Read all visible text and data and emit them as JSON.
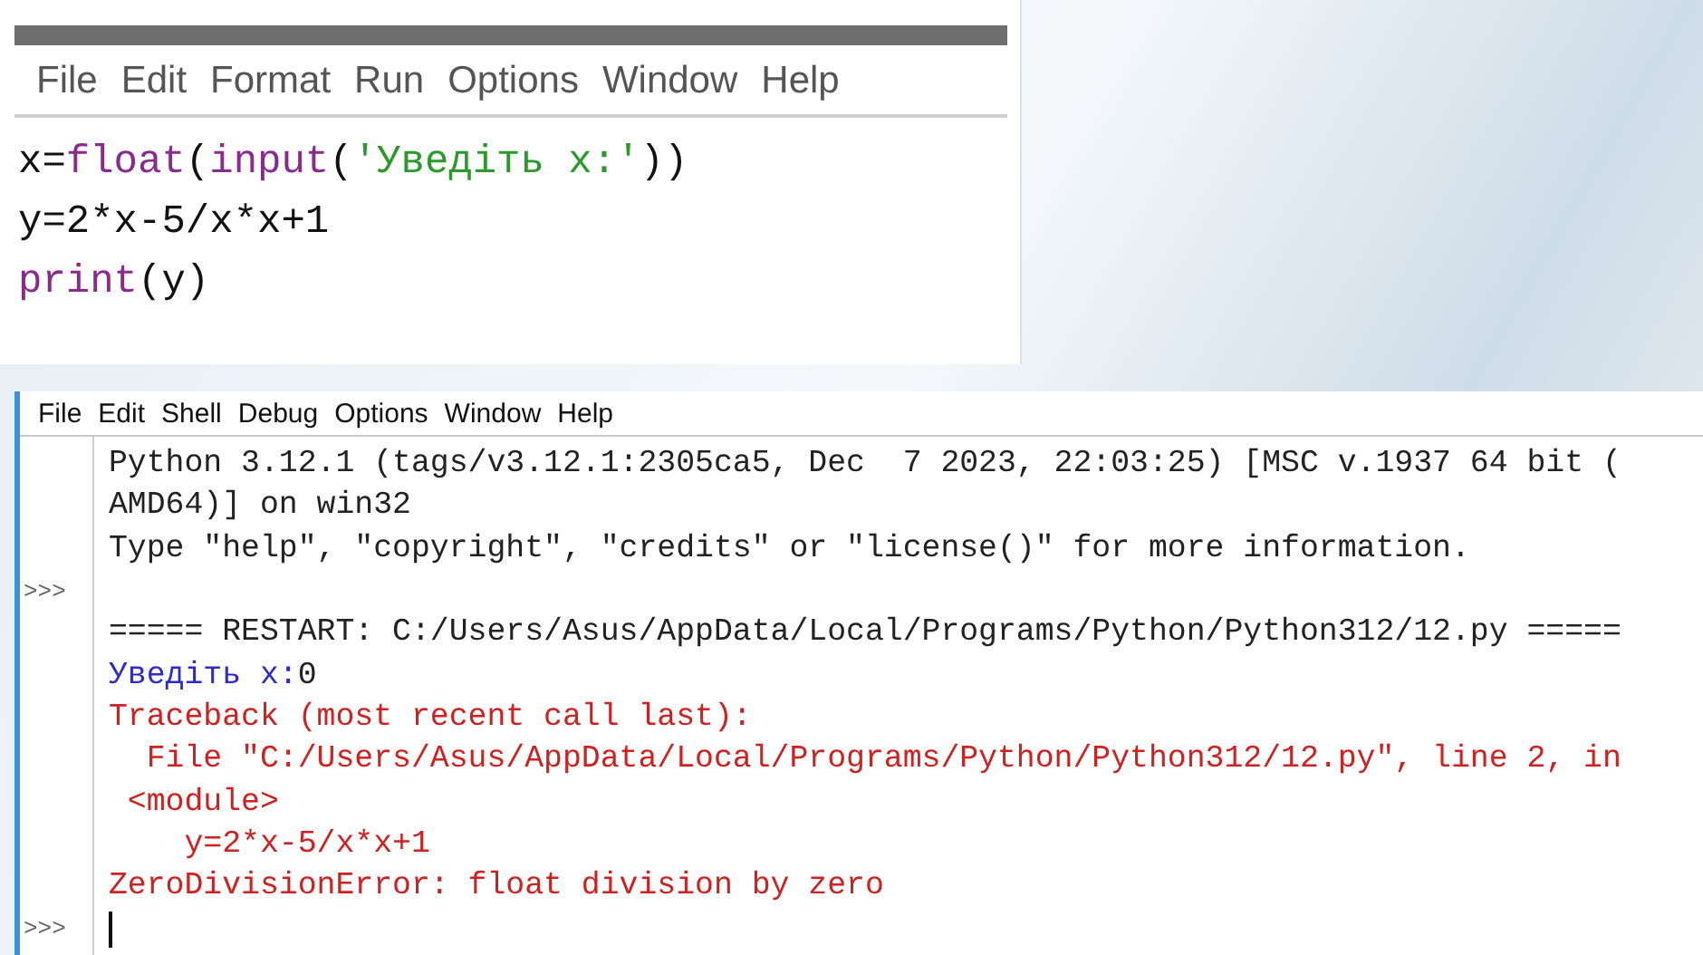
{
  "editor": {
    "menu": [
      "File",
      "Edit",
      "Format",
      "Run",
      "Options",
      "Window",
      "Help"
    ],
    "code": [
      [
        {
          "kind": "plain",
          "text": "x="
        },
        {
          "kind": "builtin",
          "text": "float"
        },
        {
          "kind": "plain",
          "text": "("
        },
        {
          "kind": "builtin",
          "text": "input"
        },
        {
          "kind": "plain",
          "text": "("
        },
        {
          "kind": "string",
          "text": "'Уведіть x:'"
        },
        {
          "kind": "plain",
          "text": "))"
        }
      ],
      [
        {
          "kind": "plain",
          "text": "y=2*x-5/x*x+1"
        }
      ],
      [
        {
          "kind": "builtin",
          "text": "print"
        },
        {
          "kind": "plain",
          "text": "(y)"
        }
      ]
    ]
  },
  "shell": {
    "menu": [
      "File",
      "Edit",
      "Shell",
      "Debug",
      "Options",
      "Window",
      "Help"
    ],
    "lines": [
      {
        "kind": "output",
        "text": "Python 3.12.1 (tags/v3.12.1:2305ca5, Dec  7 2023, 22:03:25) [MSC v.1937 64 bit ("
      },
      {
        "kind": "output",
        "text": "AMD64)] on win32"
      },
      {
        "kind": "output",
        "text": "Type \"help\", \"copyright\", \"credits\" or \"license()\" for more information."
      },
      {
        "kind": "output",
        "prompt": ">>>"
      },
      {
        "kind": "output",
        "text": "===== RESTART: C:/Users/Asus/AppData/Local/Programs/Python/Python312/12.py ====="
      },
      {
        "kind": "stdin",
        "text": "Уведіть x:",
        "input": "0"
      },
      {
        "kind": "error",
        "text": "Traceback (most recent call last):"
      },
      {
        "kind": "error",
        "text": "  File \"C:/Users/Asus/AppData/Local/Programs/Python/Python312/12.py\", line 2, in"
      },
      {
        "kind": "error",
        "text": " <module>"
      },
      {
        "kind": "error",
        "text": "    y=2*x-5/x*x+1"
      },
      {
        "kind": "error",
        "text": "ZeroDivisionError: float division by zero"
      },
      {
        "kind": "cursor",
        "prompt": ">>>"
      }
    ]
  }
}
